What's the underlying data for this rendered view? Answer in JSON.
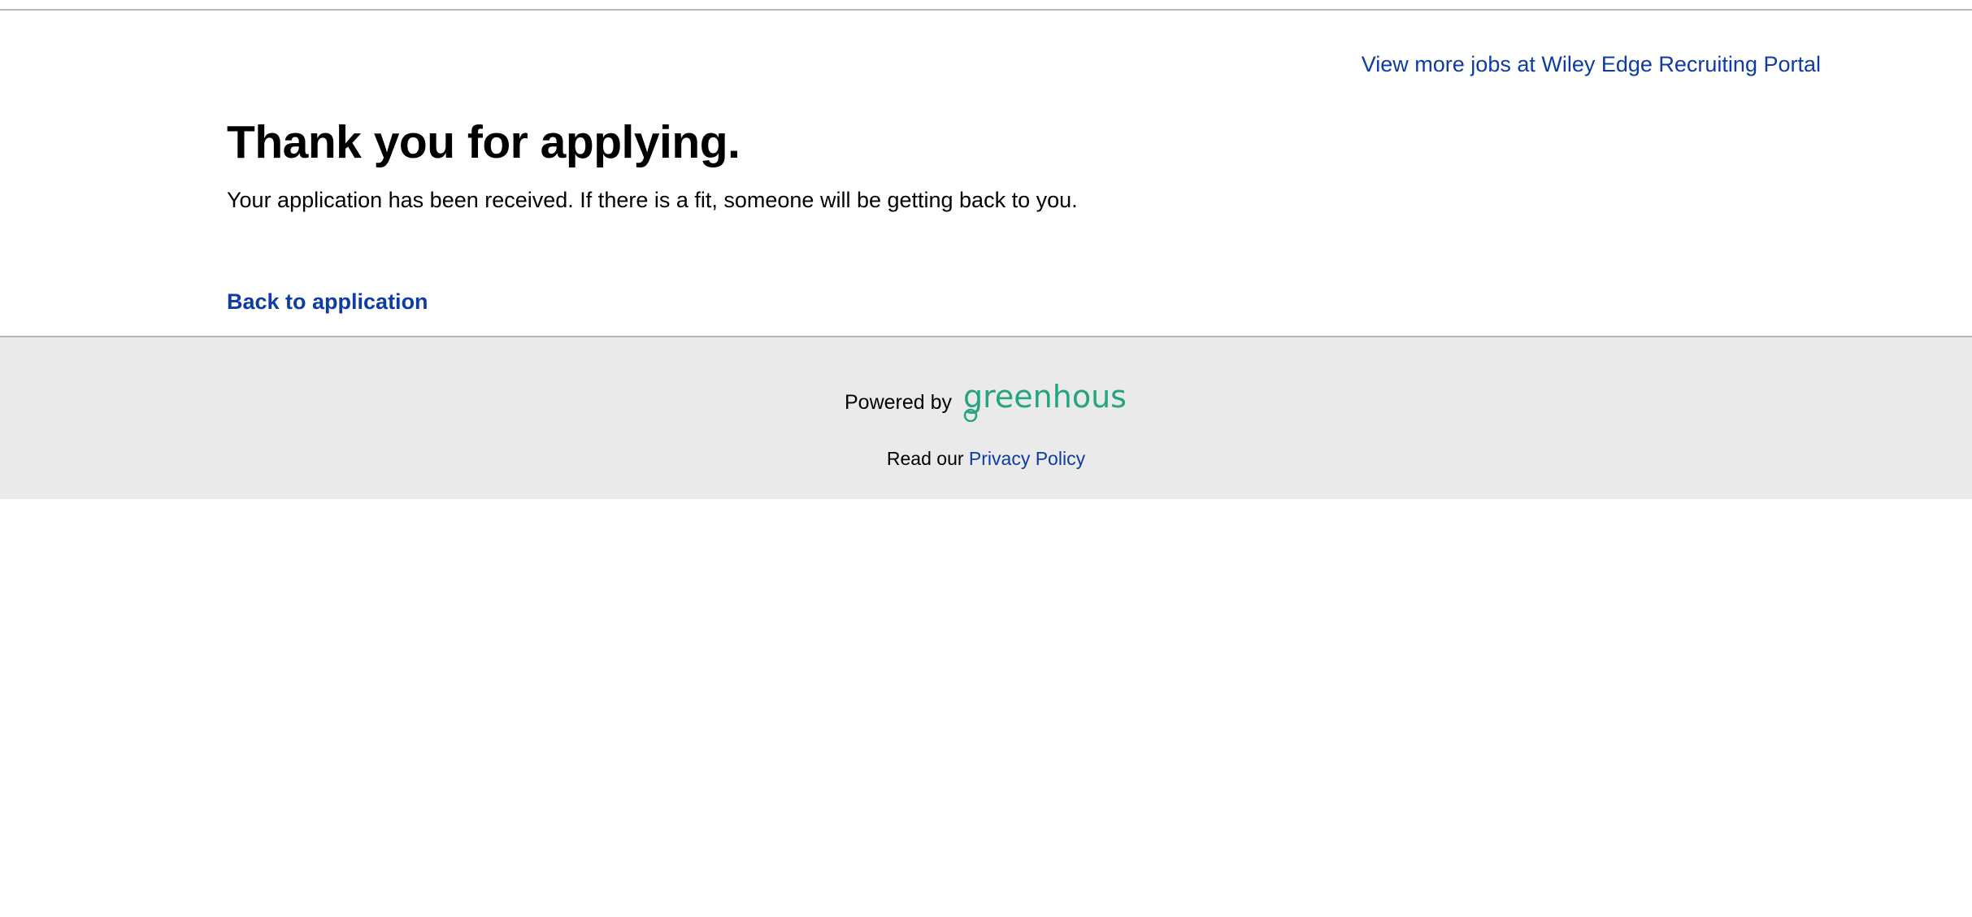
{
  "header": {
    "more_jobs_link": "View more jobs at Wiley Edge Recruiting Portal"
  },
  "main": {
    "title": "Thank you for applying.",
    "message": "Your application has been received. If there is a fit, someone will be getting back to you.",
    "back_link": "Back to application"
  },
  "footer": {
    "powered_by": "Powered by",
    "logo_text": "greenhouse",
    "privacy_prefix": "Read our",
    "privacy_link": "Privacy Policy"
  },
  "colors": {
    "link": "#0e3ca5",
    "brand_green": "#24a47f",
    "footer_bg": "#eaeaea"
  }
}
